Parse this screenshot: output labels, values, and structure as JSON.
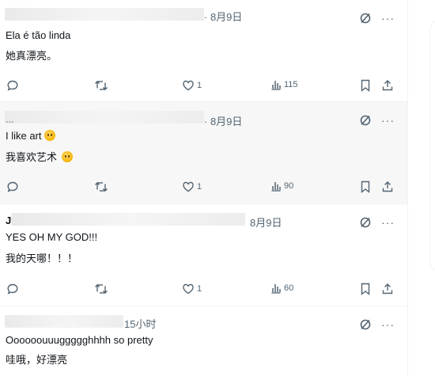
{
  "tweets": [
    {
      "date": "· 8月9日",
      "line1": "Ela é tão linda",
      "line2": "她真漂亮。",
      "likes": "1",
      "views": "115"
    },
    {
      "handle": "...",
      "date": "· 8月9日",
      "line1": "I like art",
      "line2": "我喜欢艺术",
      "likes": "1",
      "views": "90"
    },
    {
      "handle": "J",
      "date": "8月9日",
      "line1": "YES OH MY GOD!!!",
      "line2": "我的天哪！！！",
      "likes": "1",
      "views": "60"
    },
    {
      "date": "15小时",
      "line1": "Oooooouuuggggghhhh so pretty",
      "line2": "哇哦，好漂亮"
    }
  ],
  "icons": {
    "grok": "grok-icon",
    "more": "more-icon",
    "reply": "reply-icon",
    "repost": "repost-icon",
    "like": "heart-icon",
    "views": "views-icon",
    "bookmark": "bookmark-icon",
    "share": "share-icon"
  },
  "colors": {
    "text": "#0f1419",
    "secondary": "#536471",
    "border": "#eff3f4",
    "hover_bg": "#f7f7f7"
  }
}
